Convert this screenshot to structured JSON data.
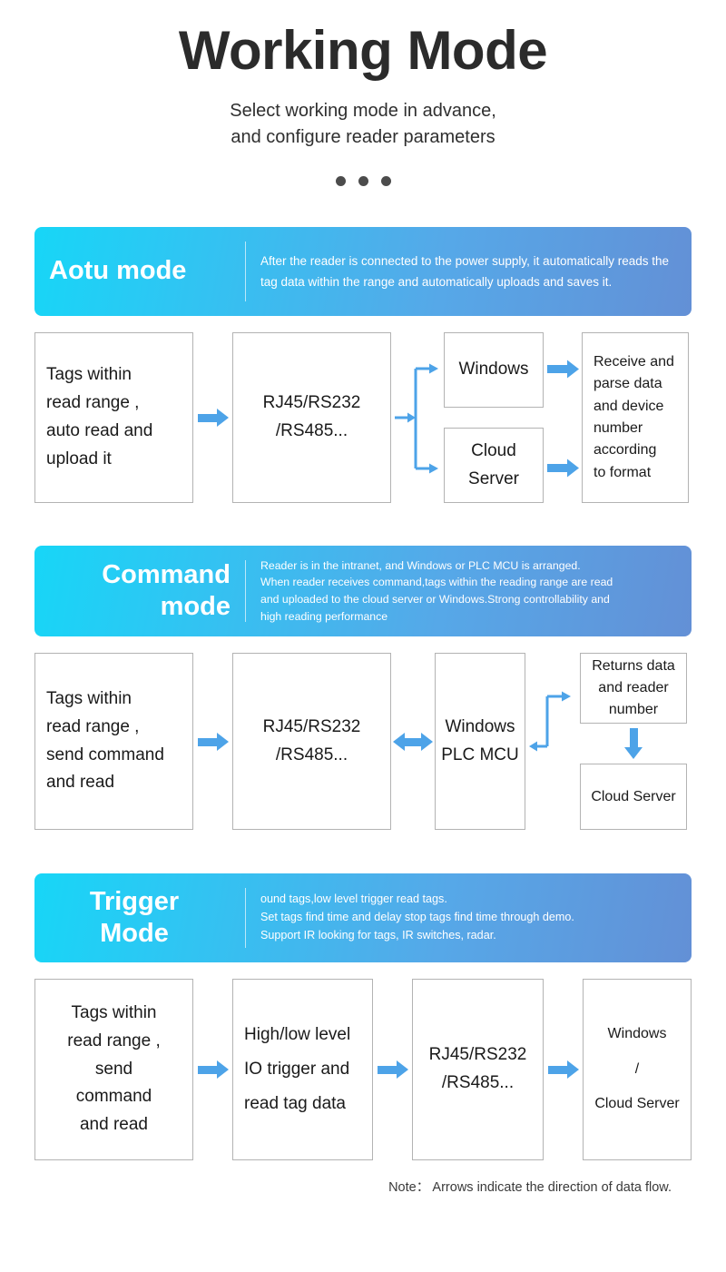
{
  "header": {
    "title": "Working Mode",
    "subtitle_line1": "Select working mode in advance,",
    "subtitle_line2": "and configure reader parameters",
    "dots_count": 3
  },
  "colors": {
    "banner_gradient_start": "#17d6f7",
    "banner_gradient_end": "#6390d6",
    "arrow": "#4da3e8",
    "box_border": "#b3b3b3",
    "title_text": "#2b2b2b",
    "dot": "#4c4c4c"
  },
  "sections": [
    {
      "id": "auto-mode",
      "banner": {
        "title": "Aotu mode",
        "title_align": "left",
        "description": "After the reader is connected to the power supply, it automatically reads the tag data within the range and automatically uploads and saves it."
      },
      "flow": {
        "box1": "Tags within read range , auto read and  upload it",
        "box1_lines": [
          "Tags within",
          "read range ,",
          " auto read and",
          "  upload it"
        ],
        "box2_lines": [
          "RJ45/RS232",
          "/RS485..."
        ],
        "branch_top": "Windows",
        "branch_bottom_lines": [
          "Cloud",
          "Server"
        ],
        "box_last_lines": [
          "Receive and",
          "parse data",
          "and device",
          "number",
          "according",
          "to format"
        ]
      }
    },
    {
      "id": "command-mode",
      "banner": {
        "title_line1": "Command",
        "title_line2": "mode",
        "title_align": "right",
        "desc_lines": [
          "Reader is in the intranet, and Windows or PLC MCU is arranged.",
          "When reader receives command,tags within the reading range are read",
          "and uploaded to the cloud server or Windows.Strong controllability and",
          "high reading performance"
        ]
      },
      "flow": {
        "box1_lines": [
          "Tags within",
          "read range ,",
          "send command",
          "and read"
        ],
        "box2_lines": [
          "RJ45/RS232",
          "/RS485..."
        ],
        "box3_lines": [
          "Windows",
          "PLC MCU"
        ],
        "box4_lines": [
          "Returns data",
          "and reader",
          "number"
        ],
        "box5": "Cloud Server"
      }
    },
    {
      "id": "trigger-mode",
      "banner": {
        "title_line1": "Trigger",
        "title_line2": "Mode",
        "title_align": "center",
        "desc_lines": [
          "ound tags,low level trigger read tags.",
          "Set tags find time and delay stop tags find time through demo.",
          "Support IR looking for tags, IR switches, radar."
        ]
      },
      "flow": {
        "box1_lines": [
          "Tags within",
          "read range ,",
          "send",
          "command",
          "and read"
        ],
        "box2_lines": [
          "High/low level",
          "IO trigger and",
          "read tag data"
        ],
        "box3_lines": [
          "RJ45/RS232",
          "/RS485..."
        ],
        "box4_lines": [
          "Windows",
          "/",
          "Cloud Server"
        ]
      }
    }
  ],
  "footer": {
    "note": "Note： Arrows indicate the direction of data flow."
  }
}
